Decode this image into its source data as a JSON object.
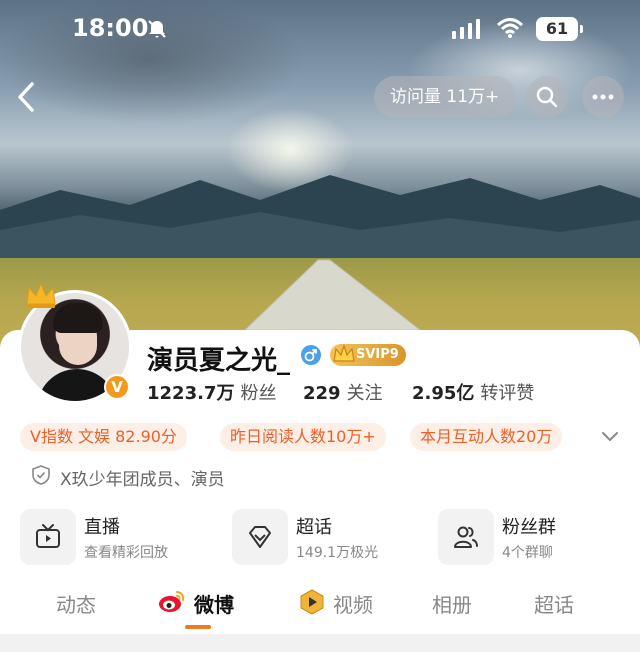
{
  "status_bar": {
    "time": "18:00",
    "battery": "61"
  },
  "nav": {
    "visits_label": "访问量 11万+",
    "visits_chevron": "›"
  },
  "profile": {
    "name": "演员夏之光_",
    "svip": "SVIP9",
    "verified_badge": "V",
    "stats": [
      {
        "value": "1223.7万",
        "label": "粉丝"
      },
      {
        "value": "229",
        "label": "关注"
      },
      {
        "value": "2.95亿",
        "label": "转评赞"
      }
    ],
    "tags": [
      "V指数 文娱 82.90分",
      "昨日阅读人数10万+",
      "本月互动人数20万"
    ],
    "description": "X玖少年团成员、演员"
  },
  "features": [
    {
      "title": "直播",
      "subtitle": "查看精彩回放",
      "icon": "tv-icon"
    },
    {
      "title": "超话",
      "subtitle": "149.1万极光",
      "icon": "diamond-icon"
    },
    {
      "title": "粉丝群",
      "subtitle": "4个群聊",
      "icon": "group-icon"
    }
  ],
  "tabs": [
    {
      "label": "动态"
    },
    {
      "label": "微博",
      "active": true
    },
    {
      "label": "视频"
    },
    {
      "label": "相册"
    },
    {
      "label": "超话"
    }
  ],
  "colors": {
    "accent": "#f07a1f",
    "tag_text": "#e8622a",
    "tag_bg": "#fdeee6",
    "verified": "#f39a1e"
  }
}
